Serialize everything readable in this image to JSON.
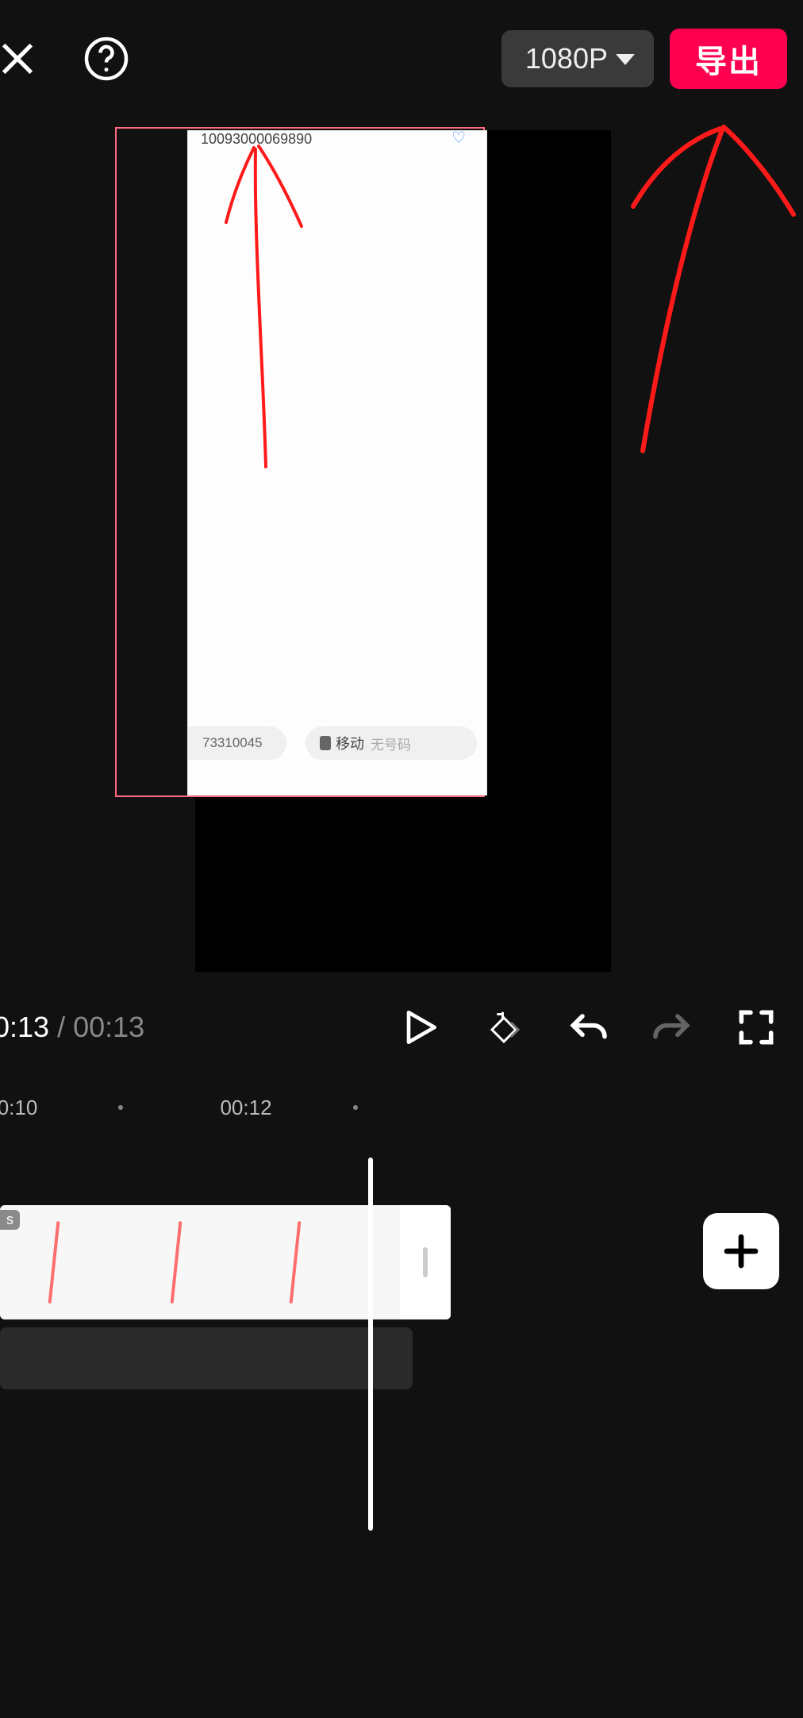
{
  "topbar": {
    "resolution_label": "1080P",
    "export_label": "导出"
  },
  "preview": {
    "inner_top_text": "10093000069890",
    "pill_left_text": "73310045",
    "pill_right_sim": "移动",
    "pill_right_status": "无号码"
  },
  "playback": {
    "current_time": "0:13",
    "separator": "/",
    "total_time": "00:13"
  },
  "timeline": {
    "ruler_ticks": [
      "0:10",
      "00:12"
    ],
    "clip_tag": "s"
  },
  "colors": {
    "accent": "#ff0050",
    "annotation": "#ff1a1a"
  }
}
